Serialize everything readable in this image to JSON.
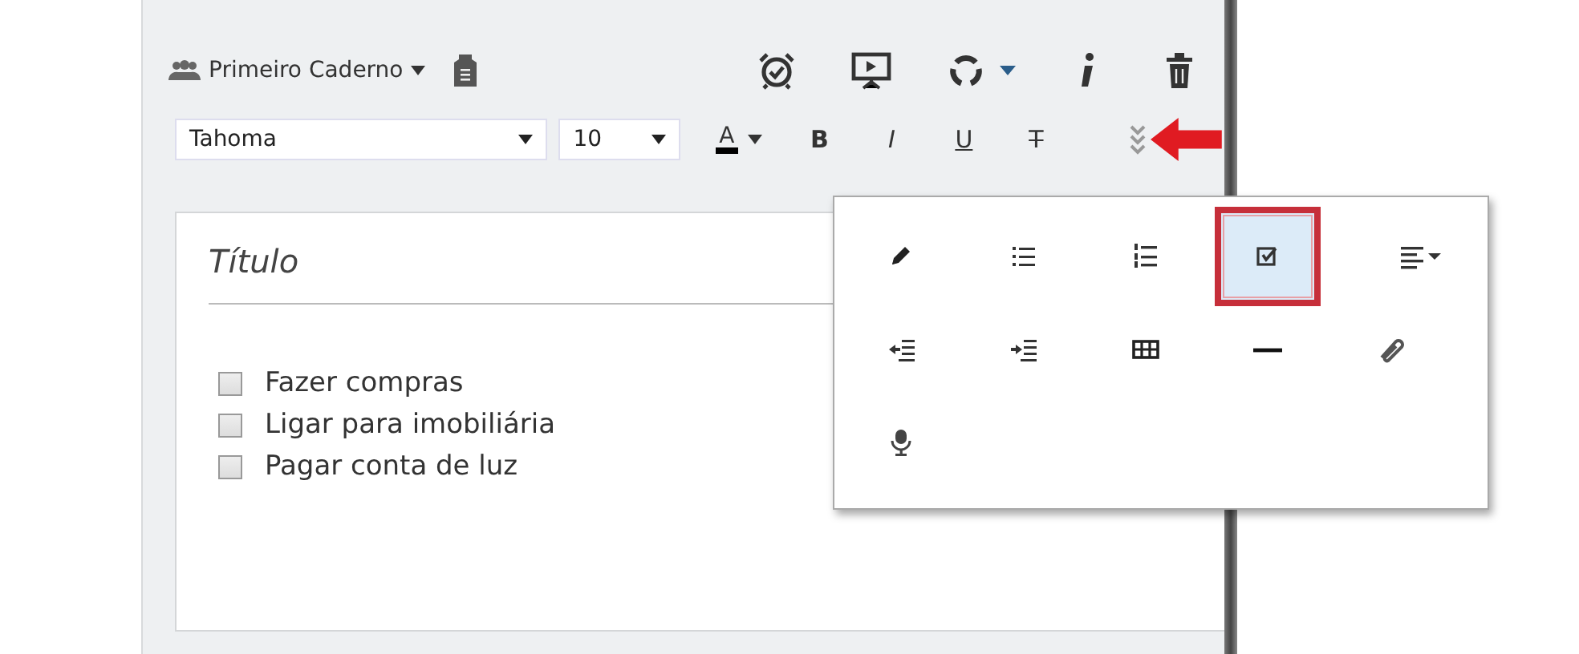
{
  "notebook": {
    "name": "Primeiro Caderno"
  },
  "font_select": {
    "value": "Tahoma"
  },
  "size_select": {
    "value": "10"
  },
  "text_color": {
    "label": "A",
    "color": "#000000"
  },
  "format_buttons": [
    {
      "label": "B",
      "kind": "bold"
    },
    {
      "label": "I",
      "kind": "italic"
    },
    {
      "label": "U",
      "kind": "underline"
    },
    {
      "label": "T",
      "kind": "strike"
    }
  ],
  "note": {
    "title_placeholder": "Título",
    "checklist": [
      {
        "text": "Fazer compras",
        "checked": false
      },
      {
        "text": "Ligar para imobiliária",
        "checked": false
      },
      {
        "text": "Pagar conta de luz",
        "checked": false
      }
    ]
  },
  "insert_menu": {
    "items": [
      {
        "kind": "pencil",
        "selected": false
      },
      {
        "kind": "bullets",
        "selected": false
      },
      {
        "kind": "numbers",
        "selected": false
      },
      {
        "kind": "checkbox",
        "selected": true
      },
      {
        "kind": "align",
        "selected": false
      },
      {
        "kind": "outdent",
        "selected": false
      },
      {
        "kind": "indent",
        "selected": false
      },
      {
        "kind": "table",
        "selected": false
      },
      {
        "kind": "rule",
        "selected": false
      },
      {
        "kind": "attach",
        "selected": false
      },
      {
        "kind": "mic",
        "selected": false
      }
    ]
  }
}
